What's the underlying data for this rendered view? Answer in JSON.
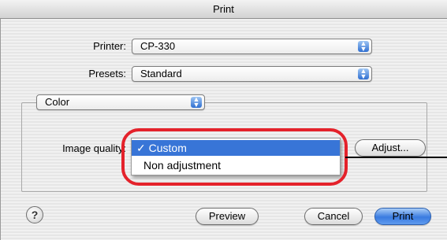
{
  "window": {
    "title": "Print"
  },
  "printer": {
    "label": "Printer:",
    "value": "CP-330"
  },
  "presets": {
    "label": "Presets:",
    "value": "Standard"
  },
  "panel": {
    "value": "Color"
  },
  "image_quality": {
    "label": "Image quality:",
    "options": [
      {
        "label": "✓ Custom",
        "selected": true
      },
      {
        "label": "Non adjustment",
        "selected": false
      }
    ]
  },
  "buttons": {
    "adjust": "Adjust...",
    "preview": "Preview",
    "cancel": "Cancel",
    "print": "Print",
    "help": "?"
  },
  "colors": {
    "selection": "#3875d7",
    "highlight": "#e4222b",
    "default_button": "#3a7be0"
  }
}
